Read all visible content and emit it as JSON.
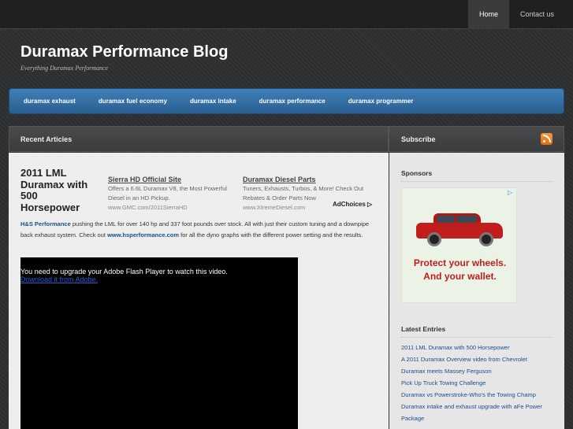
{
  "topnav": {
    "home": "Home",
    "contact": "Contact us"
  },
  "site": {
    "title": "Duramax Performance Blog",
    "tagline": "Everything Duramax Performance"
  },
  "catnav": [
    "duramax exhaust",
    "duramax fuel economy",
    "duramax intake",
    "duramax performance",
    "duramax programmer"
  ],
  "main": {
    "header": "Recent Articles"
  },
  "post": {
    "title": "2011 LML Duramax with 500 Horsepower",
    "body_link1": "H&S Performance",
    "body_text1": " pushing the LML for over 140 hp and 337 foot pounds over stock. All with just their custom tuning and  a downpipe back exhaust system. Check out ",
    "body_link2": "www.hsperformance.com",
    "body_text2": "  for all the dyno graphs with the different power setting and the results."
  },
  "ads": [
    {
      "title": "Sierra HD Official Site",
      "text": "Offers a 6.6L Duramax V8, the Most Powerful Diesel in an HD Pickup.",
      "url": "www.GMC.com/2011SierraHD"
    },
    {
      "title": "Duramax Diesel Parts",
      "text": "Tuners, Exhausts, Turbos, & More! Check Out Rebates & Order Parts Now",
      "url": "www.XtremeDiesel.com"
    }
  ],
  "adchoices": "AdChoices",
  "video": {
    "message": "You need to upgrade your Adobe Flash Player to watch this video.",
    "link": "Download it from Adobe."
  },
  "sidebar": {
    "subscribe": "Subscribe",
    "sponsors": "Sponsors",
    "ad_line1": "Protect your wheels.",
    "ad_line2": "And your wallet.",
    "latest": "Latest Entries",
    "entries": [
      "2011 LML Duramax with 500 Horsepower",
      "A 2011 Duramax Overview video from Chevrolet",
      "Duramax meets Massey Ferguson",
      "Pick Up Truck Towing Challenge",
      "Duramax vs Powerstroke-Who's the Towing Champ",
      "Duramax intake and exhaust upgrade with aFe Power Package"
    ]
  }
}
